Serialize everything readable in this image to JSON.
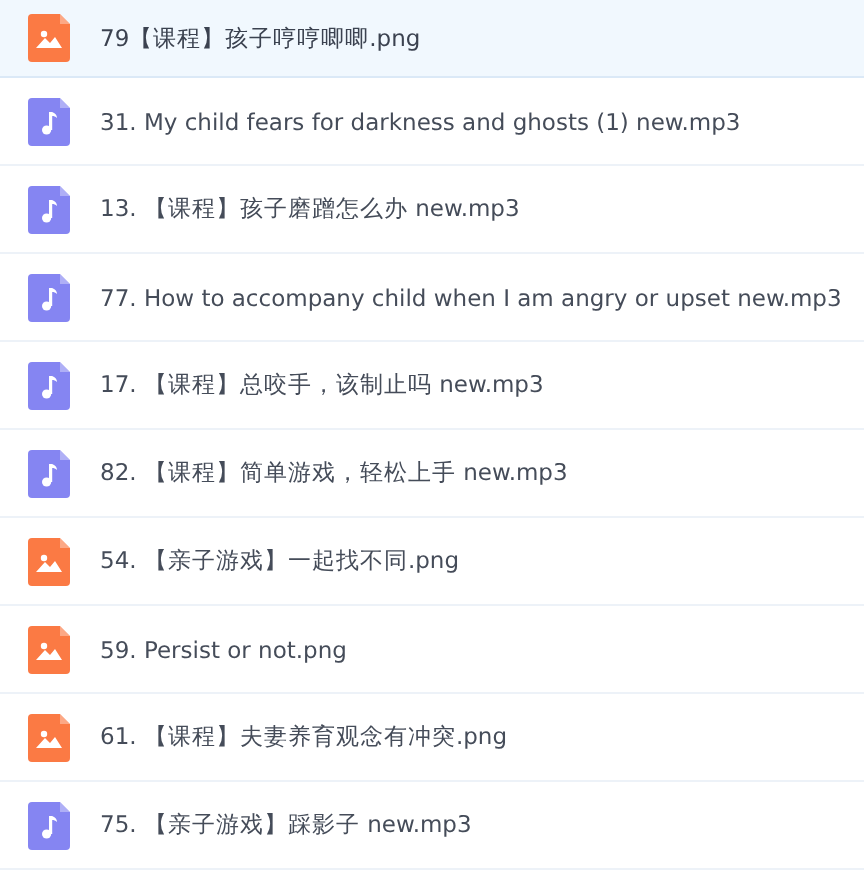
{
  "files": [
    {
      "kind": "image",
      "name": "79【课程】孩子哼哼唧唧.png",
      "selected": true
    },
    {
      "kind": "audio",
      "name": "31. My child fears for darkness and ghosts (1) new.mp3",
      "selected": false
    },
    {
      "kind": "audio",
      "name": "13. 【课程】孩子磨蹭怎么办 new.mp3",
      "selected": false
    },
    {
      "kind": "audio",
      "name": "77. How to accompany child when I am angry or upset new.mp3",
      "selected": false
    },
    {
      "kind": "audio",
      "name": "17. 【课程】总咬手，该制止吗 new.mp3",
      "selected": false
    },
    {
      "kind": "audio",
      "name": "82. 【课程】简单游戏，轻松上手 new.mp3",
      "selected": false
    },
    {
      "kind": "image",
      "name": "54. 【亲子游戏】一起找不同.png",
      "selected": false
    },
    {
      "kind": "image",
      "name": "59. Persist or not.png",
      "selected": false
    },
    {
      "kind": "image",
      "name": "61. 【课程】夫妻养育观念有冲突.png",
      "selected": false
    },
    {
      "kind": "audio",
      "name": "75. 【亲子游戏】踩影子 new.mp3",
      "selected": false
    }
  ]
}
